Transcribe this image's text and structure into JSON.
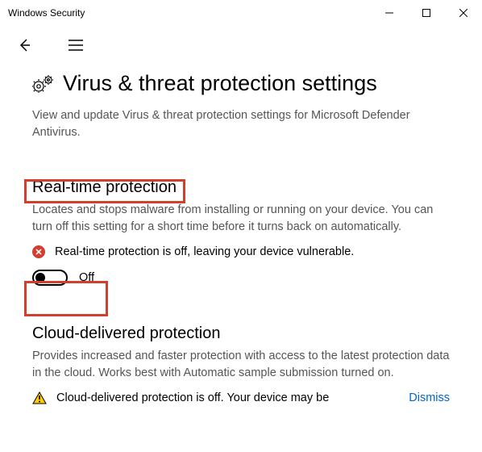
{
  "window": {
    "title": "Windows Security"
  },
  "page": {
    "title": "Virus & threat protection settings",
    "subtitle": "View and update Virus & threat protection settings for Microsoft Defender Antivirus."
  },
  "sections": {
    "realtime": {
      "title": "Real-time protection",
      "desc": "Locates and stops malware from installing or running on your device. You can turn off this setting for a short time before it turns back on automatically.",
      "alert": "Real-time protection is off, leaving your device vulnerable.",
      "toggle_state": "Off"
    },
    "cloud": {
      "title": "Cloud-delivered protection",
      "desc": "Provides increased and faster protection with access to the latest protection data in the cloud. Works best with Automatic sample submission turned on.",
      "alert": "Cloud-delivered protection is off. Your device may be",
      "dismiss": "Dismiss"
    }
  }
}
